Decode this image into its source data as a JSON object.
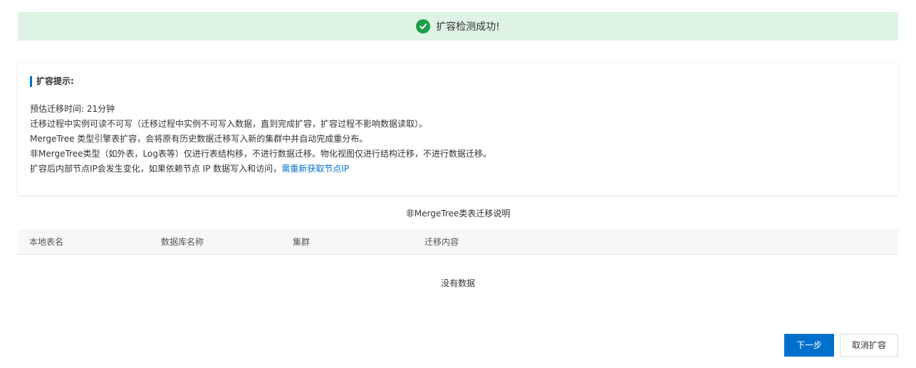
{
  "banner": {
    "icon": "check-circle-icon",
    "text": "扩容检测成功!",
    "color": "#1e9e4a",
    "background": "#dff3e4"
  },
  "notice": {
    "title": "扩容提示:",
    "lines": [
      "预估迁移时间: 21分钟",
      "迁移过程中实例可读不可写（迁移过程中实例不可写入数据，直到完成扩容，扩容过程不影响数据读取）。",
      "MergeTree 类型引擎表扩容，会将原有历史数据迁移写入新的集群中并自动完成重分布。",
      "非MergeTree类型（如外表，Log表等）仅进行表结构移，不进行数据迁移。物化视图仅进行结构迁移，不进行数据迁移。",
      "扩容后内部节点IP会发生变化，如果依赖节点 IP 数据写入和访问，"
    ],
    "link_text": "需重新获取节点IP",
    "accent_color": "#0070cc"
  },
  "table": {
    "caption": "非MergeTree类表迁移说明",
    "columns": [
      "本地表名",
      "数据库名称",
      "集群",
      "迁移内容"
    ],
    "empty_text": "没有数据"
  },
  "footer": {
    "next_label": "下一步",
    "cancel_label": "取消扩容",
    "primary_color": "#0070cc"
  }
}
